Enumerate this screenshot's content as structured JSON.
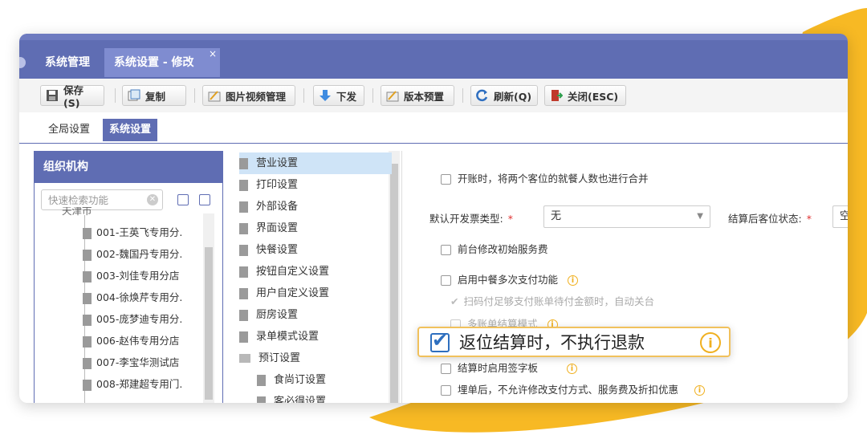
{
  "tabs": [
    {
      "label": "系统管理"
    },
    {
      "label": "系统设置 - 修改"
    }
  ],
  "tab_close": "×",
  "toolbar": {
    "save": "保存(S)",
    "copy": "复制",
    "media": "图片视频管理",
    "dispatch": "下发",
    "version_preset": "版本预置",
    "refresh": "刷新(Q)",
    "close": "关闭(ESC)"
  },
  "subtabs": {
    "global": "全局设置",
    "system": "系统设置"
  },
  "org": {
    "title": "组织机构",
    "search_placeholder": "快速检索功能",
    "partial_top": "天津市",
    "stores": [
      "001-王英飞专用分.",
      "002-魏国丹专用分.",
      "003-刘佳专用分店",
      "004-徐焕芹专用分.",
      "005-庞梦迪专用分.",
      "006-赵伟专用分店",
      "007-李宝华测试店",
      "008-郑建超专用门."
    ]
  },
  "menu": {
    "items": [
      "营业设置",
      "打印设置",
      "外部设备",
      "界面设置",
      "快餐设置",
      "按钮自定义设置",
      "用户自定义设置",
      "厨房设置",
      "录单模式设置",
      "预订设置"
    ],
    "sub_items": [
      "食尚订设置",
      "客必得设置"
    ]
  },
  "settings": {
    "merge_guests": "开账时，将两个客位的就餐人数也进行合并",
    "invoice_type_label": "默认开发票类型:",
    "invoice_type_value": "无",
    "after_settle_label": "结算后客位状态:",
    "after_settle_value": "空",
    "required_mark": "*",
    "front_modify_service": "前台修改初始服务费",
    "multi_pay": "启用中餐多次支付功能",
    "auto_close": "扫码付足够支付账单待付金额时，自动关台",
    "multi_bill": "多账单结算模式",
    "signature": "结算时启用签字板",
    "no_modify_after_bill": "埋单后，不允许修改支付方式、服务费及折扣优惠"
  },
  "callout": {
    "text": "返位结算时，不执行退款"
  },
  "colors": {
    "brand": "#5f6db3",
    "accent": "#f7b924",
    "info": "#f0b020"
  }
}
